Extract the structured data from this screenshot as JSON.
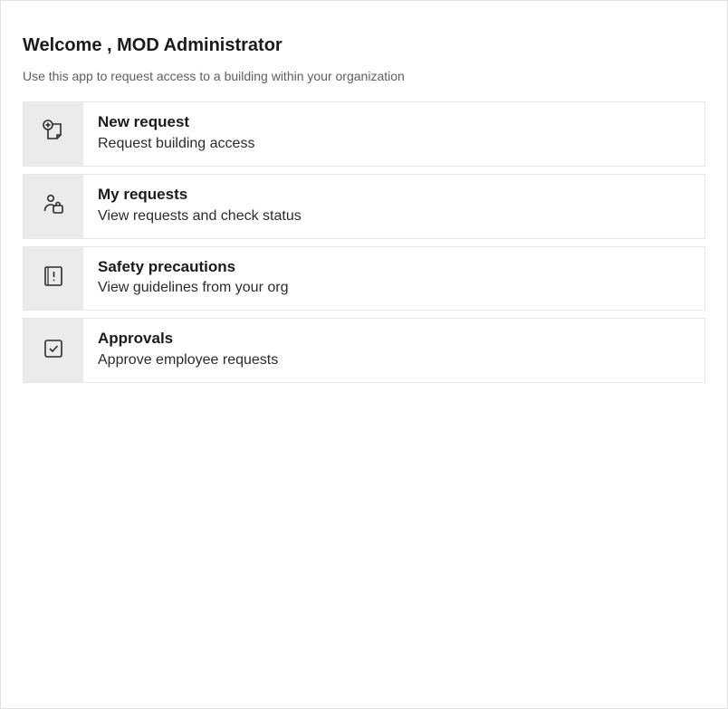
{
  "header": {
    "title": "Welcome , MOD Administrator",
    "subtitle": "Use this app to request access to a building within your organization"
  },
  "cards": [
    {
      "icon": "plus-note-icon",
      "title": "New request",
      "desc": "Request building access"
    },
    {
      "icon": "person-bag-icon",
      "title": "My requests",
      "desc": "View requests and check status"
    },
    {
      "icon": "alert-page-icon",
      "title": "Safety precautions",
      "desc": "View guidelines from your org"
    },
    {
      "icon": "check-box-icon",
      "title": "Approvals",
      "desc": "Approve employee requests"
    }
  ]
}
